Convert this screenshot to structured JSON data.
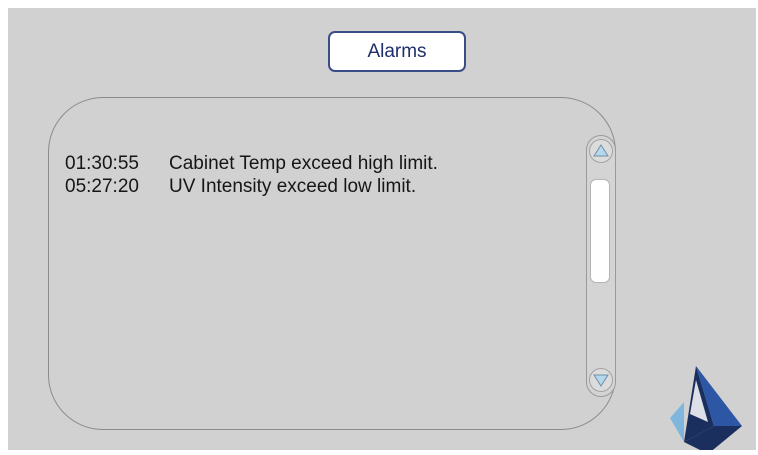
{
  "header": {
    "alarms_button_label": "Alarms"
  },
  "alarms": [
    {
      "time": "01:30:55",
      "message": "Cabinet Temp exceed high limit."
    },
    {
      "time": "05:27:20",
      "message": "UV Intensity exceed low limit."
    }
  ],
  "scrollbar": {
    "up_icon": "triangle-up-icon",
    "down_icon": "triangle-down-icon"
  },
  "logo": {
    "icon": "pyramid-logo-icon"
  },
  "colors": {
    "background": "#d1d1d1",
    "button_border": "#3a4d86",
    "button_text": "#1f2f6b",
    "arrow_fill": "#b6d8ec",
    "logo_dark": "#1b2f5e",
    "logo_mid": "#2d57a4",
    "logo_light": "#7fb6dd"
  }
}
